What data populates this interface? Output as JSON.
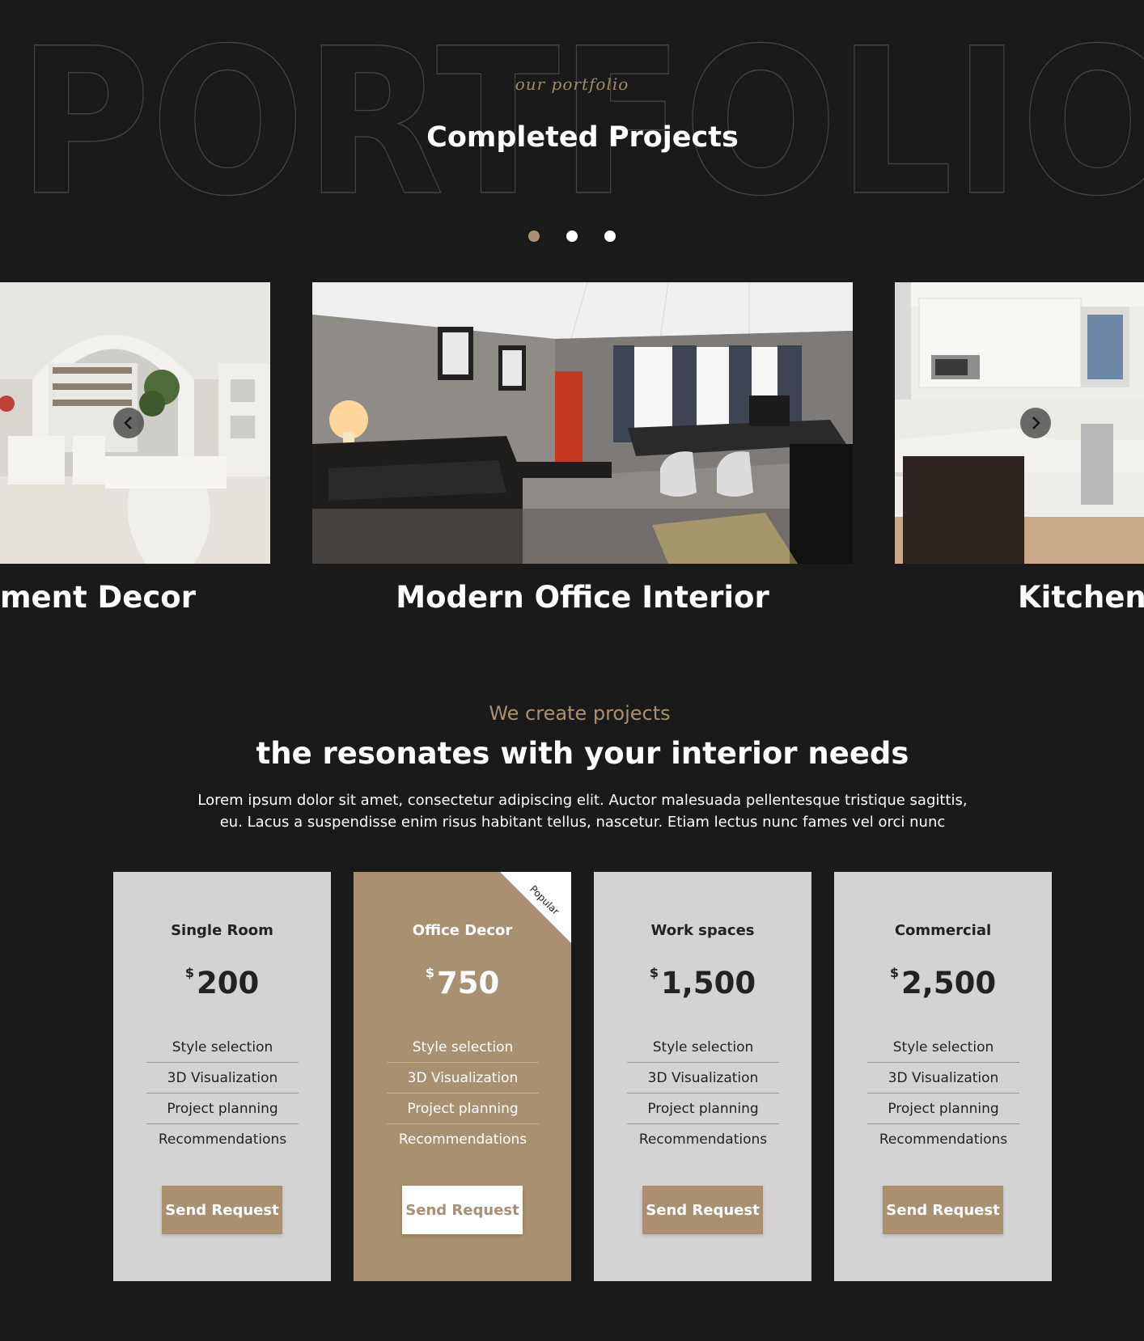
{
  "hero": {
    "background_word": "PORTFOLIO",
    "script_label": "our portfolio",
    "title": "Completed Projects",
    "pagination_dots": 3,
    "active_dot": 0
  },
  "slider": {
    "slides": [
      {
        "caption": "ment Decor"
      },
      {
        "caption": "Modern Office Interior"
      },
      {
        "caption": "Kitchen I"
      }
    ]
  },
  "intro": {
    "subtitle": "We create projects",
    "title": "the resonates with your interior needs",
    "text": "Lorem ipsum dolor sit amet, consectetur adipiscing elit. Auctor malesuada pellentesque tristique sagittis, eu. Lacus a suspendisse enim risus habitant tellus, nascetur. Etiam lectus nunc fames vel orci nunc"
  },
  "pricing": {
    "currency_symbol": "$",
    "plans": [
      {
        "name": "Single Room",
        "price": "200",
        "features": [
          "Style selection",
          "3D Visualization",
          "Project planning",
          "Recommendations"
        ],
        "button": "Send Request"
      },
      {
        "name": "Office Decor",
        "price": "750",
        "badge": "Popular",
        "features": [
          "Style selection",
          "3D Visualization",
          "Project planning",
          "Recommendations"
        ],
        "button": "Send Request"
      },
      {
        "name": "Work spaces",
        "price": "1,500",
        "features": [
          "Style selection",
          "3D Visualization",
          "Project planning",
          "Recommendations"
        ],
        "button": "Send Request"
      },
      {
        "name": "Commercial",
        "price": "2,500",
        "features": [
          "Style selection",
          "3D Visualization",
          "Project planning",
          "Recommendations"
        ],
        "button": "Send Request"
      }
    ]
  },
  "colors": {
    "background": "#1a1a1a",
    "accent": "#a89070",
    "card": "#d3d3d3"
  },
  "icons": {
    "prev": "chevron-left-icon",
    "next": "chevron-right-icon"
  }
}
